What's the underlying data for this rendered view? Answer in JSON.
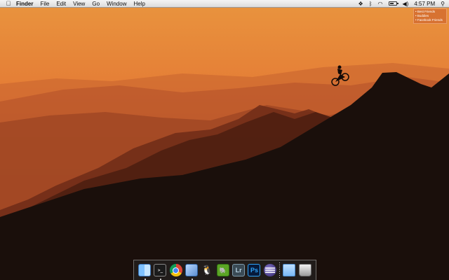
{
  "menubar": {
    "apple_icon": "apple-icon",
    "app_name": "Finder",
    "menus": [
      "File",
      "Edit",
      "View",
      "Go",
      "Window",
      "Help"
    ],
    "status_icons": [
      "dropbox-icon",
      "bluetooth-icon",
      "wifi-icon",
      "battery-icon",
      "volume-icon"
    ],
    "battery_level": 0.6,
    "clock": "4:57 PM",
    "search_icon": "spotlight-search-icon"
  },
  "notification_widget": {
    "items": [
      "• Best Friends",
      "• Buddies",
      "• Facebook Friends"
    ]
  },
  "dock": {
    "apps": [
      {
        "name": "Finder",
        "icon": "finder-icon",
        "running": true
      },
      {
        "name": "Terminal",
        "icon": "terminal-icon",
        "label": ">_",
        "running": true
      },
      {
        "name": "Google Chrome",
        "icon": "chrome-icon",
        "running": true
      },
      {
        "name": "Preview",
        "icon": "preview-icon",
        "running": true
      },
      {
        "name": "Adium",
        "icon": "tux-icon",
        "label": "🐧",
        "running": false
      },
      {
        "name": "Evernote",
        "icon": "evernote-icon",
        "label": "🐘",
        "running": true
      },
      {
        "name": "Lightroom",
        "icon": "lightroom-icon",
        "label": "Lr",
        "running": false
      },
      {
        "name": "Photoshop",
        "icon": "photoshop-icon",
        "label": "Ps",
        "running": false
      },
      {
        "name": "Eclipse",
        "icon": "eclipse-icon",
        "running": false
      },
      {
        "name": "Applications",
        "icon": "folder-icon",
        "running": false
      },
      {
        "name": "Trash",
        "icon": "trash-icon",
        "running": false
      }
    ]
  },
  "wallpaper": {
    "sky_top": "#f08a3a",
    "sky_bottom": "#c55a2a",
    "mountain_dark": "#1a0f0b"
  }
}
